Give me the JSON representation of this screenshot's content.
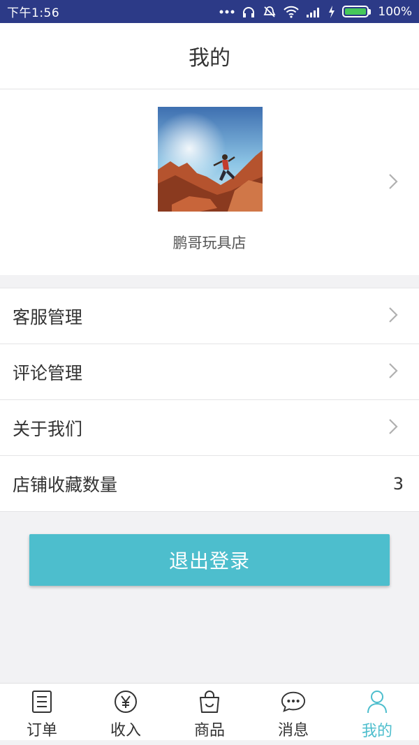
{
  "status": {
    "time": "下午1:56",
    "battery": "100%"
  },
  "header": {
    "title": "我的"
  },
  "profile": {
    "store_name": "鹏哥玩具店"
  },
  "menu": [
    {
      "label": "客服管理",
      "value": ""
    },
    {
      "label": "评论管理",
      "value": ""
    },
    {
      "label": "关于我们",
      "value": ""
    },
    {
      "label": "店铺收藏数量",
      "value": "3"
    }
  ],
  "logout": {
    "label": "退出登录"
  },
  "tabs": [
    {
      "label": "订单",
      "icon": "order-list-icon"
    },
    {
      "label": "收入",
      "icon": "yuan-icon"
    },
    {
      "label": "商品",
      "icon": "shopping-bag-icon"
    },
    {
      "label": "消息",
      "icon": "chat-bubble-icon"
    },
    {
      "label": "我的",
      "icon": "person-icon"
    }
  ],
  "colors": {
    "accent": "#4dbecd",
    "statusbar": "#2c3a87",
    "battery": "#46c85a"
  }
}
